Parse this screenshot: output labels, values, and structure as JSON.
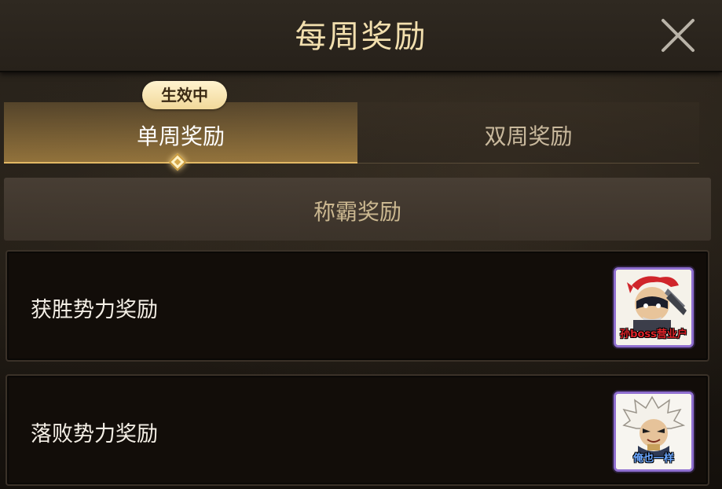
{
  "header": {
    "title": "每周奖励",
    "close_icon": "close-icon"
  },
  "tabs": [
    {
      "label": "单周奖励",
      "active": true,
      "badge": "生效中"
    },
    {
      "label": "双周奖励",
      "active": false
    }
  ],
  "section": {
    "title": "称霸奖励"
  },
  "rewards": [
    {
      "label": "获胜势力奖励",
      "icon": "warlord-avatar-icon",
      "icon_caption": "孙boss营业户",
      "frame_color": "#8f6fd0"
    },
    {
      "label": "落败势力奖励",
      "icon": "white-hair-avatar-icon",
      "icon_caption": "俺也一样",
      "frame_color": "#8f6fd0"
    }
  ],
  "colors": {
    "title": "#f2dfae",
    "active_tab": "#e2b864",
    "badge": "#f1d89a",
    "section_title": "#d8c49a"
  }
}
